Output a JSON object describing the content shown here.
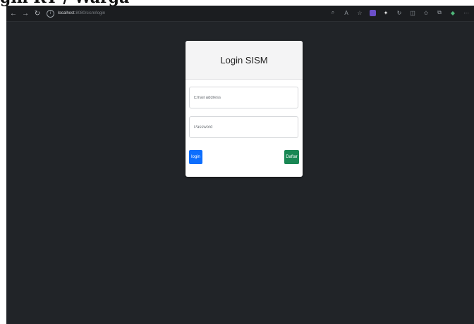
{
  "caption": "gin RT / Warga",
  "browser": {
    "url_host": "localhost",
    "url_path": ":8080/sism/login",
    "icons": [
      "back-icon",
      "forward-icon",
      "reload-icon",
      "info-icon",
      "zoom-icon",
      "read-aloud-icon",
      "favorite-icon",
      "extension-icon",
      "puzzle-icon",
      "refresh-icon",
      "split-screen-icon",
      "favorites-icon",
      "collections-icon",
      "copilot-icon",
      "more-icon"
    ]
  },
  "login_card": {
    "title": "Login SISM",
    "email_placeholder": "Email address",
    "password_placeholder": "Password",
    "login_label": "login",
    "register_label": "Daftar"
  },
  "colors": {
    "background": "#212428",
    "login_button": "#0d6efd",
    "register_button": "#198754"
  }
}
